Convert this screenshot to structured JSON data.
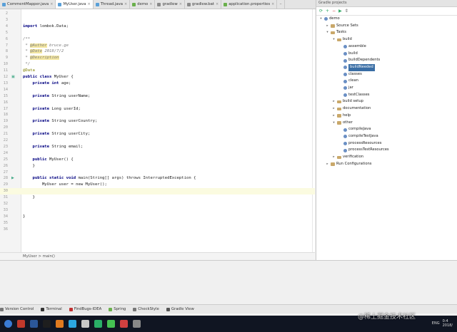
{
  "tabs": [
    {
      "label": "CommentMapper.java",
      "color": "#5aa0d8"
    },
    {
      "label": "MyUser.java",
      "color": "#5aa0d8"
    },
    {
      "label": "Thread.java",
      "color": "#5aa0d8"
    },
    {
      "label": "demo",
      "color": "#6ab04c"
    },
    {
      "label": "gradlew",
      "color": "#8a8a8a"
    },
    {
      "label": "gradlew.bat",
      "color": "#8a8a8a"
    },
    {
      "label": "application.properties",
      "color": "#6ab04c"
    }
  ],
  "tab_overflow": "··",
  "lines": [
    {
      "n": "2"
    },
    {
      "n": "3"
    },
    {
      "n": "4",
      "k": "import ",
      "t": "lombok.Data;"
    },
    {
      "n": "5"
    },
    {
      "n": "6",
      "c": "/**"
    },
    {
      "n": "7",
      "c": " * ",
      "g": "@Author",
      " c2": " bruce.ge"
    },
    {
      "n": "8",
      "c": " * ",
      "g": "@Date",
      " c2": " 2018/7/2"
    },
    {
      "n": "9",
      "c": " * ",
      "g": "@Description"
    },
    {
      "n": "10",
      "c": " */"
    },
    {
      "n": "11",
      "a": "@Data"
    },
    {
      "n": "12",
      "k": "public class ",
      "t": "MyUser {"
    },
    {
      "n": "13",
      "k": "    private int ",
      "t": "age;"
    },
    {
      "n": "14"
    },
    {
      "n": "15",
      "k": "    private ",
      "t": "String userName;"
    },
    {
      "n": "16"
    },
    {
      "n": "17",
      "k": "    private ",
      "t": "Long userId;"
    },
    {
      "n": "18"
    },
    {
      "n": "19",
      "k": "    private ",
      "t": "String userCountry;"
    },
    {
      "n": "20"
    },
    {
      "n": "21",
      "k": "    private ",
      "t": "String userCity;"
    },
    {
      "n": "22"
    },
    {
      "n": "23",
      "k": "    private ",
      "t": "String email;"
    },
    {
      "n": "24"
    },
    {
      "n": "25",
      "k": "    public ",
      "t": "MyUser() {"
    },
    {
      "n": "26",
      "t": "    }"
    },
    {
      "n": "27"
    },
    {
      "n": "28",
      "k": "    public static void ",
      "t": "main(String[] args) throws InterruptedException {"
    },
    {
      "n": "29",
      "t": "        MyUser user = new MyUser();"
    },
    {
      "n": "30",
      "t": ""
    },
    {
      "n": "31",
      "t": "    }"
    },
    {
      "n": "32"
    },
    {
      "n": "33"
    },
    {
      "n": "34",
      "t": "}"
    },
    {
      "n": "35"
    },
    {
      "n": "36"
    }
  ],
  "current_line_index": 28,
  "breadcrumb": "MyUser  >  main()",
  "gradle_panel": {
    "title": "Gradle projects",
    "tree": [
      {
        "label": "demo",
        "depth": 0,
        "icon": "gear",
        "arrow": "▾"
      },
      {
        "label": "Source Sets",
        "depth": 1,
        "icon": "folder",
        "arrow": "▸"
      },
      {
        "label": "Tasks",
        "depth": 1,
        "icon": "folder",
        "arrow": "▾"
      },
      {
        "label": "build",
        "depth": 2,
        "icon": "folder",
        "arrow": "▾"
      },
      {
        "label": "assemble",
        "depth": 3,
        "icon": "gear"
      },
      {
        "label": "build",
        "depth": 3,
        "icon": "gear"
      },
      {
        "label": "buildDependents",
        "depth": 3,
        "icon": "gear"
      },
      {
        "label": "buildNeeded",
        "depth": 3,
        "icon": "gear",
        "selected": true
      },
      {
        "label": "classes",
        "depth": 3,
        "icon": "gear"
      },
      {
        "label": "clean",
        "depth": 3,
        "icon": "gear"
      },
      {
        "label": "jar",
        "depth": 3,
        "icon": "gear"
      },
      {
        "label": "testClasses",
        "depth": 3,
        "icon": "gear"
      },
      {
        "label": "build setup",
        "depth": 2,
        "icon": "folder",
        "arrow": "▸"
      },
      {
        "label": "documentation",
        "depth": 2,
        "icon": "folder",
        "arrow": "▸"
      },
      {
        "label": "help",
        "depth": 2,
        "icon": "folder",
        "arrow": "▸"
      },
      {
        "label": "other",
        "depth": 2,
        "icon": "folder",
        "arrow": "▾"
      },
      {
        "label": "compileJava",
        "depth": 3,
        "icon": "gear"
      },
      {
        "label": "compileTestJava",
        "depth": 3,
        "icon": "gear"
      },
      {
        "label": "processResources",
        "depth": 3,
        "icon": "gear"
      },
      {
        "label": "processTestResources",
        "depth": 3,
        "icon": "gear"
      },
      {
        "label": "verification",
        "depth": 2,
        "icon": "folder",
        "arrow": "▸"
      },
      {
        "label": "Run Configurations",
        "depth": 1,
        "icon": "folder",
        "arrow": "▸"
      }
    ]
  },
  "tool_windows": [
    {
      "label": "Version Control",
      "color": "#777"
    },
    {
      "label": "Terminal",
      "color": "#333"
    },
    {
      "label": "FindBugs-IDEA",
      "color": "#c03030"
    },
    {
      "label": "Spring",
      "color": "#6ab04c"
    },
    {
      "label": "CheckStyle",
      "color": "#777"
    },
    {
      "label": "Gradle View",
      "color": "#555"
    }
  ],
  "taskbar_apps": [
    "#3a7bd5",
    "#c0392b",
    "#2b579a",
    "#1e1e1e",
    "#e07a1f",
    "#2ca6e0",
    "#c8c8c8",
    "#2aae67",
    "#45c152",
    "#d04040",
    "#888888"
  ],
  "tray": {
    "lang": "ENG",
    "time": "0:4",
    "date": "2018/"
  },
  "watermark": "@稀土掘金技术社区"
}
